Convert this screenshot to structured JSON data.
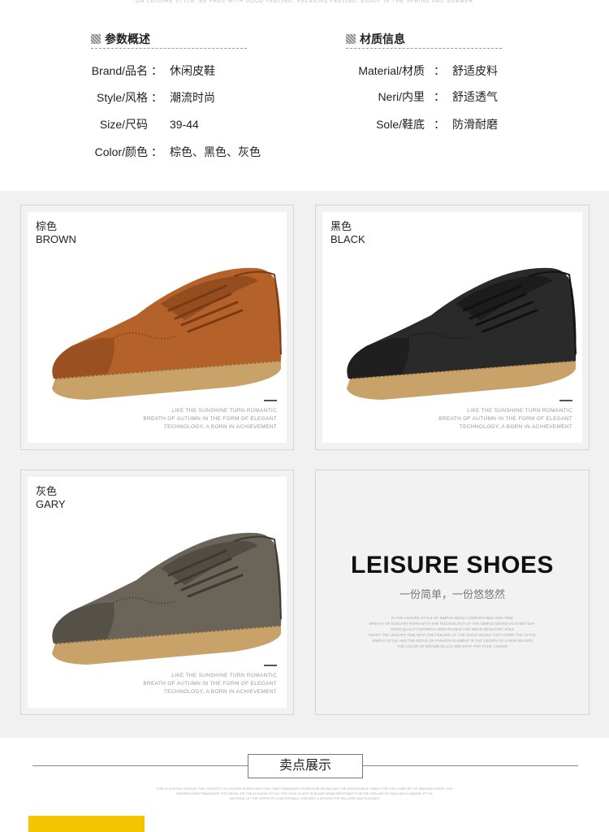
{
  "top_caption": "ON LEISURE STYLE, BE FREE WITH GOOD FEELING, RELAXING FEELING, ENJOY IN THE SPRING AND SUMMER",
  "params": {
    "title": "参数概述",
    "rows": [
      {
        "label": "Brand/品名",
        "value": "休闲皮鞋"
      },
      {
        "label": "Style/风格",
        "value": "潮流时尚"
      },
      {
        "label": "Size/尺码",
        "value": "39-44"
      },
      {
        "label": "Color/颜色",
        "value": "棕色、黑色、灰色"
      }
    ]
  },
  "material": {
    "title": "材质信息",
    "rows": [
      {
        "label": "Material/材质",
        "value": "舒适皮料"
      },
      {
        "label": "Neri/内里",
        "value": "舒适透气"
      },
      {
        "label": "Sole/鞋底",
        "value": "防滑耐磨"
      }
    ]
  },
  "colon": "：",
  "panels": [
    {
      "cn": "棕色",
      "en": "BROWN",
      "color": "#b5622a",
      "dark": "#7a3b14"
    },
    {
      "cn": "黑色",
      "en": "BLACK",
      "color": "#2a2a2a",
      "dark": "#111111"
    },
    {
      "cn": "灰色",
      "en": "GARY",
      "color": "#6b6459",
      "dark": "#3e3a33"
    }
  ],
  "panel_note": [
    "LIKE THE SUNSHINE TURN ROMANTIC",
    "BREATH OF AUTUMN IN THE FORM OF ELEGANT",
    "TECHNOLOGY, A BORN IN ACHIEVEMENT"
  ],
  "leisure": {
    "title": "LEISURE SHOES",
    "subtitle": "一份简单，一份悠悠然",
    "fine": [
      "IN THE LEISURE STYLE OF SIMPLE BEING COMFORTABLE AND FREE",
      "BREATH OF ELEGANT FORM WITH THE TECHNOLOGY OF THE SIMPLE DESIGN IN EVERY DAY",
      "GOOD QUALITY MATERIAL BREATHABLE AND WEAR RESISTANT SOLE",
      "ENJOY THE LEISURE TIME WITH THE FEELING OF THE GOOD SHOES THAT CARRY THE STYLE",
      "SIMPLE STYLE AND THE DETAIL OF FASHION ELEMENT IN THE DESIGN OF A NEW SEASON",
      "THE COLOR OF BROWN BLACK AND GRAY FOR YOUR CHOICE"
    ]
  },
  "selling": {
    "title": "卖点展示",
    "fine": [
      "THIS IS A DETAIL DISPLAY, THE CONCEPT OF LEISURE SHOES WITH THE CRAFTSMANSHIP OF BROGUE DETAIL AND THE BREATHABLE LINING FOR THE COMFORT OF WALKING EVERY DAY",
      "REFINED CRAFTSMANSHIP, THE DETAIL OF THE ELEGANT STYLE, THE SOLE IS ANTI SLIP AND WEAR RESISTANT FOR THE FEELING OF WALKING A UNIQUE STYLE",
      "MATERIAL OF THE UPPER IS COMFORTABLE LEATHER, A DESIGN FOR RELAXED AND ELEGANT"
    ]
  }
}
